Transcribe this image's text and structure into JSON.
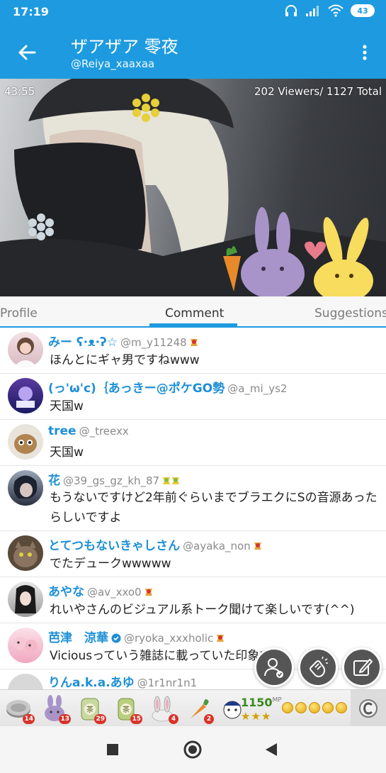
{
  "status_bar": {
    "time": "17:19",
    "battery": "43",
    "icons": [
      "headphones-icon",
      "signal-icon",
      "wifi-icon",
      "battery-icon"
    ]
  },
  "header": {
    "title": "ザアザア 零夜",
    "subtitle": "@Reiya_xaaxaa",
    "accent_color": "#1e9be0"
  },
  "video": {
    "elapsed": "43:55",
    "viewers": "202 Viewers/ 1127 Total"
  },
  "tabs": [
    {
      "label": "Profile"
    },
    {
      "label": "Comment",
      "active": true
    },
    {
      "label": "Suggestions"
    }
  ],
  "comments": [
    {
      "name": "みー ʕ·ᴥ·ʔ☆",
      "handle": "@m_y11248",
      "text": "ほんとにギャ男ですねwww",
      "badge": "red-ribbon"
    },
    {
      "name": "(っ'ω'c)｛あっきー@ポケGO勢",
      "handle": "@a_mi_ys2",
      "text": "天国w"
    },
    {
      "name": "tree",
      "handle": "@_treexx",
      "text": "天国w"
    },
    {
      "name": "花",
      "handle": "@39_gs_gz_kh_87",
      "text": "もうないですけど2年前ぐらいまでブラエクにSの音源あったらしいですよ",
      "badge": "green-ribbon"
    },
    {
      "name": "とてつもないきゃしさん",
      "handle": "@ayaka_non",
      "text": "でたデュークwwwww",
      "badge": "red-ribbon"
    },
    {
      "name": "あやな",
      "handle": "@av_xxo0",
      "text": "れいやさんのビジュアル系トーク聞けて楽しいです(^^)",
      "badge": "red-ribbon"
    },
    {
      "name": "芭津　涼華",
      "handle": "@ryoka_xxxholic",
      "text": "Viciousっていう雑誌に載っていた印象です",
      "badge": "red-ribbon"
    },
    {
      "name": "りんa.k.a.あゆ",
      "handle": "@1r1nr1n1",
      "text": ""
    }
  ],
  "gifts": [
    {
      "icon": "coin-gift-icon",
      "count": "14"
    },
    {
      "icon": "purple-bunny-gift-icon",
      "count": "13"
    },
    {
      "icon": "tea-10-gift-icon",
      "count": "29"
    },
    {
      "icon": "tea-gift-icon",
      "count": "15"
    },
    {
      "icon": "rabbit-gift-icon",
      "count": "4"
    },
    {
      "icon": "carrot-gift-icon",
      "count": "2"
    },
    {
      "icon": "maid-gift-icon",
      "count": ""
    }
  ],
  "points": {
    "value": "1150",
    "unit": "MP",
    "stars": "★★★"
  }
}
